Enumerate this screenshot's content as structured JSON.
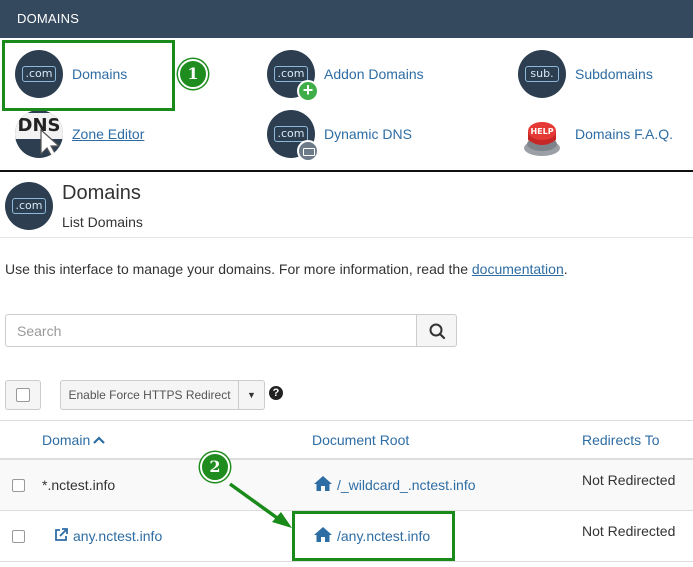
{
  "topbar": {
    "title": "DOMAINS"
  },
  "tools": [
    {
      "id": "domains",
      "label": "Domains",
      "icon": "dot-com-icon",
      "icon_text": ".com"
    },
    {
      "id": "addon",
      "label": "Addon Domains",
      "icon": "dot-com-plus-icon",
      "icon_text": ".com"
    },
    {
      "id": "subdomains",
      "label": "Subdomains",
      "icon": "sub-icon",
      "icon_text": "sub."
    },
    {
      "id": "zone",
      "label": "Zone Editor",
      "icon": "dns-icon",
      "icon_text": "DNS"
    },
    {
      "id": "ddns",
      "label": "Dynamic DNS",
      "icon": "dot-com-network-icon",
      "icon_text": ".com"
    },
    {
      "id": "faq",
      "label": "Domains F.A.Q.",
      "icon": "help-button-icon",
      "icon_text": "HELP"
    }
  ],
  "steps": {
    "one": "1",
    "two": "2"
  },
  "page": {
    "title": "Domains",
    "subtitle": "List Domains",
    "icon_text": ".com",
    "description": "Use this interface to manage your domains. For more information, read the ",
    "description_link": "documentation",
    "description_end": "."
  },
  "search": {
    "placeholder": "Search"
  },
  "actions": {
    "force_https": "Enable Force HTTPS Redirect"
  },
  "table": {
    "headers": {
      "domain": "Domain",
      "docroot": "Document Root",
      "redirects": "Redirects To"
    },
    "rows": [
      {
        "domain": "*.nctest.info",
        "docroot": "/_wildcard_.nctest.info",
        "redirect": "Not Redirected"
      },
      {
        "domain": "any.nctest.info",
        "docroot": "/any.nctest.info",
        "redirect": "Not Redirected"
      }
    ]
  },
  "colors": {
    "topbar": "#34495e",
    "link": "#2e6da4",
    "highlight": "#1a8a1a"
  }
}
